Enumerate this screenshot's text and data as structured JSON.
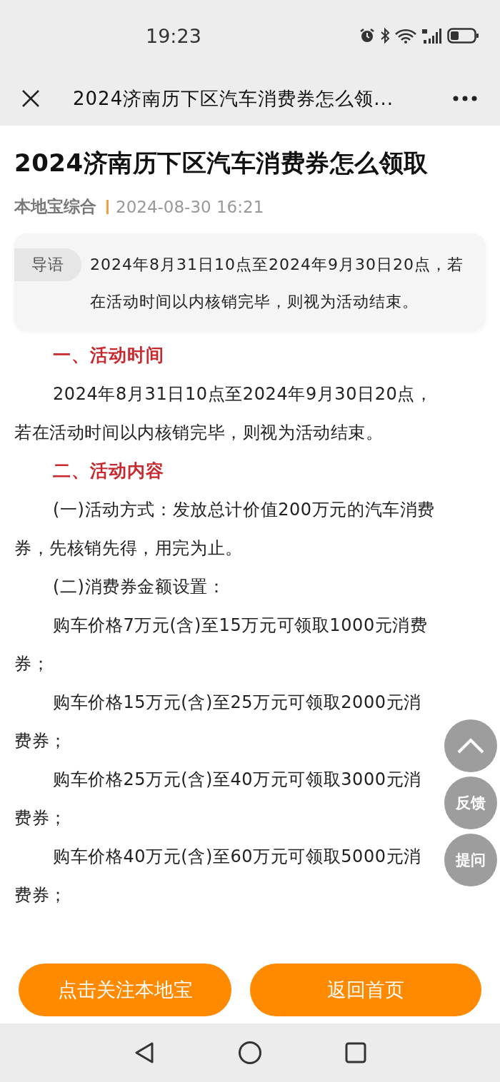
{
  "status_bar": {
    "time": "19:23"
  },
  "nav": {
    "title": "2024济南历下区汽车消费券怎么领..."
  },
  "article": {
    "title": "2024济南历下区汽车消费券怎么领取",
    "source": "本地宝综合",
    "date": "2024-08-30 16:21",
    "intro": {
      "tag": "导语",
      "text": "2024年8月31日10点至2024年9月30日20点，若在活动时间以内核销完毕，则视为活动结束。"
    },
    "content": [
      {
        "kind": "heading",
        "text": "一、活动时间"
      },
      {
        "kind": "paragraph",
        "text": "2024年8月31日10点至2024年9月30日20点，若在活动时间以内核销完毕，则视为活动结束。"
      },
      {
        "kind": "heading",
        "text": "二、活动内容"
      },
      {
        "kind": "paragraph",
        "text": "(一)活动方式：发放总计价值200万元的汽车消费券，先核销先得，用完为止。"
      },
      {
        "kind": "paragraph",
        "text": "(二)消费券金额设置："
      },
      {
        "kind": "paragraph",
        "text": "购车价格7万元(含)至15万元可领取1000元消费券；"
      },
      {
        "kind": "paragraph",
        "text": "购车价格15万元(含)至25万元可领取2000元消费券；"
      },
      {
        "kind": "paragraph",
        "text": "购车价格25万元(含)至40万元可领取3000元消费券；"
      },
      {
        "kind": "paragraph",
        "text": "购车价格40万元(含)至60万元可领取5000元消费券；"
      }
    ]
  },
  "floating_buttons": [
    {
      "kind": "icon"
    },
    {
      "kind": "text",
      "label": "反馈"
    },
    {
      "kind": "text",
      "label": "提问"
    }
  ],
  "bottom_buttons": [
    "点击关注本地宝",
    "返回首页"
  ]
}
